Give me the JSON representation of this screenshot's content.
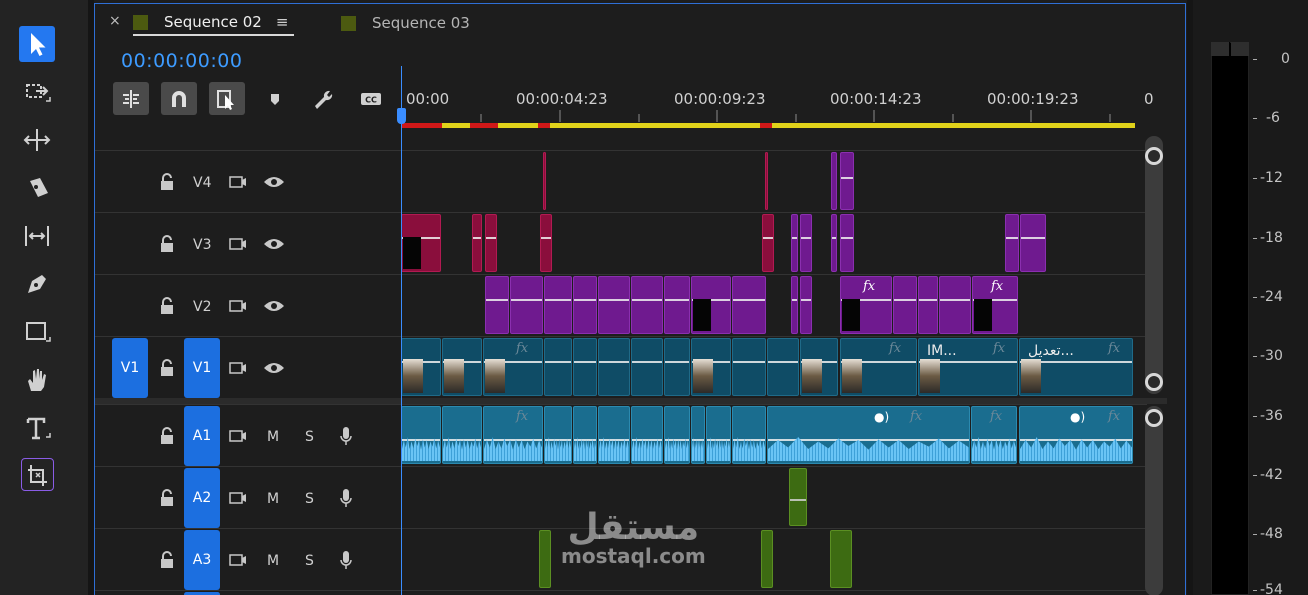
{
  "sequence_tabs": [
    {
      "label": "Sequence 02",
      "active": true
    },
    {
      "label": "Sequence 03",
      "active": false
    }
  ],
  "tab_close_glyph": "×",
  "tab_menu_glyph": "≡",
  "timecode": "00:00:00:00",
  "toolbar": {
    "tools": [
      "selection-tool",
      "track-select-forward-tool",
      "ripple-edit-tool",
      "razor-tool",
      "slip-tool",
      "pen-tool",
      "rectangle-tool",
      "hand-tool",
      "type-tool",
      "remix-tool"
    ],
    "timeline_buttons": [
      "insert-sequence-as-nest",
      "snap",
      "linked-selection",
      "add-marker",
      "timeline-settings",
      "captions"
    ]
  },
  "ruler": {
    "labels": [
      "00:00",
      "00:00:04:23",
      "00:00:09:23",
      "00:00:14:23",
      "00:00:19:23",
      "0"
    ]
  },
  "tracks": {
    "video": [
      {
        "name": "V4",
        "source_patch": ""
      },
      {
        "name": "V3",
        "source_patch": ""
      },
      {
        "name": "V2",
        "source_patch": ""
      },
      {
        "name": "V1",
        "source_patch": "V1"
      }
    ],
    "audio": [
      {
        "name": "A1",
        "mute": "M",
        "solo": "S"
      },
      {
        "name": "A2",
        "mute": "M",
        "solo": "S"
      },
      {
        "name": "A3",
        "mute": "M",
        "solo": "S"
      }
    ]
  },
  "clip_labels": {
    "fx": "fx",
    "v1_name_1": "IM...",
    "v1_name_2": "تعديل..."
  },
  "meter": {
    "labels": [
      "0",
      "-6",
      "-12",
      "-18",
      "-24",
      "-30",
      "-36",
      "-42",
      "-48",
      "-54"
    ]
  },
  "watermark": {
    "arabic": "مستقل",
    "latin": "mostaql.com"
  },
  "colors": {
    "accent": "#2478f0",
    "timecode": "#3d9bff",
    "v4_v3_clip": "#8a0e3c",
    "v2_clip": "#6f1a8f",
    "v1_clip": "#0f4c66",
    "a1_clip": "#1a6d8f",
    "a2_a3_clip": "#3d6b12",
    "work_area": "#e0d21a",
    "render_red": "#d01818"
  }
}
